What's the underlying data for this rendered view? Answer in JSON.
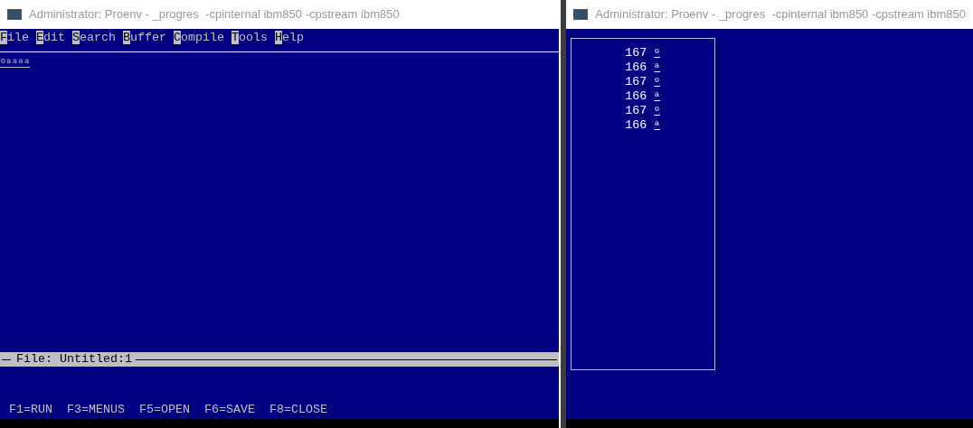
{
  "windows": [
    {
      "title": "Administrator: Proenv - _progres  -cpinternal ibm850 -cpstream ibm850",
      "menu": [
        "File",
        "Edit",
        "Search",
        "Buffer",
        "Compile",
        "Tools",
        "Help"
      ],
      "editor_text": "ºªªªª",
      "status": "File: Untitled:1",
      "function_keys": [
        "F1=RUN",
        "F3=MENUS",
        "F5=OPEN",
        "F6=SAVE",
        "F8=CLOSE"
      ]
    },
    {
      "title": "Administrator: Proenv - _progres  -cpinternal ibm850 -cpstream ibm850",
      "output_rows": [
        {
          "code": "167",
          "char": "º"
        },
        {
          "code": "166",
          "char": "ª"
        },
        {
          "code": "167",
          "char": "º"
        },
        {
          "code": "166",
          "char": "ª"
        },
        {
          "code": "167",
          "char": "º"
        },
        {
          "code": "166",
          "char": "ª"
        }
      ]
    }
  ]
}
